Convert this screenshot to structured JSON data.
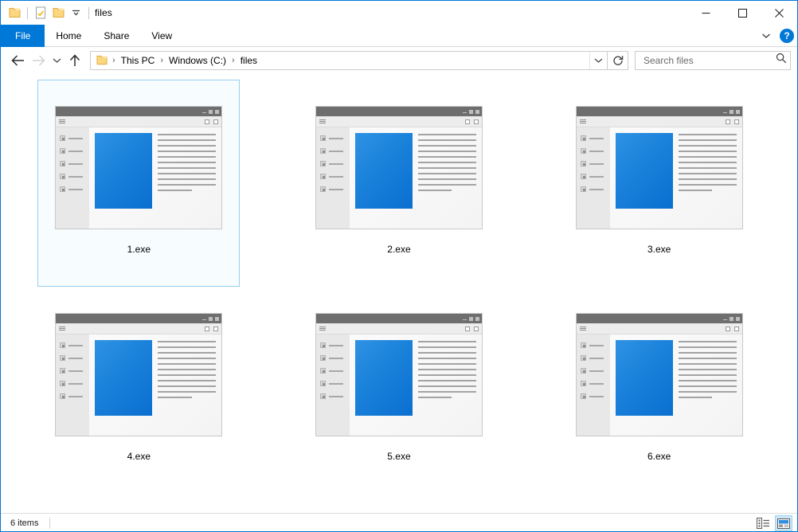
{
  "window": {
    "title": "files",
    "accent_color": "#0078d7",
    "selection_border_color": "#99d1f0"
  },
  "quick_access_toolbar": {
    "items": [
      {
        "name": "folder-icon",
        "label": "Folder"
      },
      {
        "name": "properties-icon",
        "label": "Properties"
      },
      {
        "name": "new-folder-icon",
        "label": "New folder"
      },
      {
        "name": "chevron-down-icon",
        "label": "Customize Quick Access Toolbar"
      }
    ]
  },
  "window_controls": {
    "minimize": "─",
    "maximize": "☐",
    "close": "✕"
  },
  "ribbon": {
    "tabs": [
      {
        "label": "File",
        "active": true
      },
      {
        "label": "Home",
        "active": false
      },
      {
        "label": "Share",
        "active": false
      },
      {
        "label": "View",
        "active": false
      }
    ],
    "expand_icon": "chevron-down-icon",
    "help_label": "?"
  },
  "navigation": {
    "back": {
      "name": "back-arrow-icon",
      "enabled": true
    },
    "forward": {
      "name": "forward-arrow-icon",
      "enabled": false
    },
    "recent": {
      "name": "recent-locations-icon",
      "enabled": true
    },
    "up": {
      "name": "up-arrow-icon",
      "enabled": true
    },
    "refresh": {
      "name": "refresh-icon",
      "enabled": true
    }
  },
  "address_bar": {
    "breadcrumbs": [
      "This PC",
      "Windows (C:)",
      "files"
    ],
    "separator": "›",
    "dropdown_icon": "chevron-down-icon"
  },
  "search": {
    "placeholder": "Search files",
    "value": "",
    "icon": "search-icon"
  },
  "files": [
    {
      "name": "1.exe",
      "selected": true
    },
    {
      "name": "2.exe",
      "selected": false
    },
    {
      "name": "3.exe",
      "selected": false
    },
    {
      "name": "4.exe",
      "selected": false
    },
    {
      "name": "5.exe",
      "selected": false
    },
    {
      "name": "6.exe",
      "selected": false
    }
  ],
  "thumbnail": {
    "description": "mock application window preview",
    "titlebar_color": "#6e6e6e",
    "accent_panel_color_start": "#2f93e3",
    "accent_panel_color_end": "#0a6fd0",
    "sidebar_item_count": 5,
    "text_line_count": 11
  },
  "status_bar": {
    "item_count_text": "6 items",
    "views": [
      {
        "name": "details-view-button",
        "label": "Details view",
        "active": false
      },
      {
        "name": "large-icons-view-button",
        "label": "Large icons view",
        "active": true
      }
    ]
  }
}
